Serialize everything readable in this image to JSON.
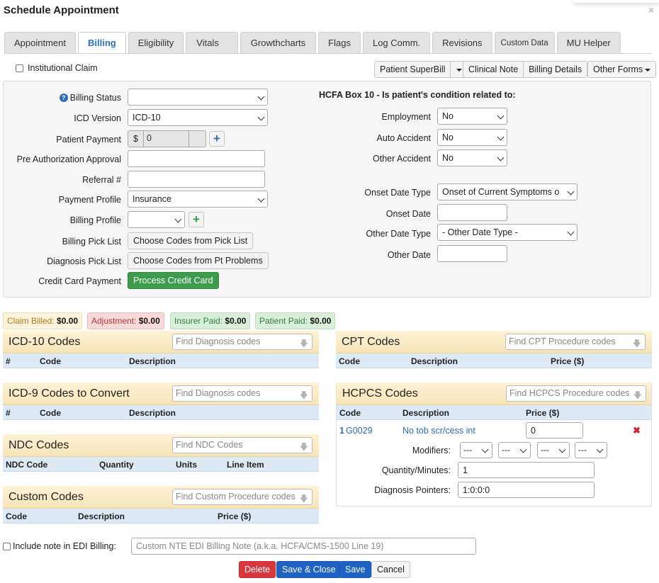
{
  "window": {
    "title": "Schedule Appointment",
    "close_label": "×"
  },
  "tabs": [
    {
      "label": "Appointment"
    },
    {
      "label": "Billing"
    },
    {
      "label": "Eligibility"
    },
    {
      "label": "Vitals"
    },
    {
      "label": "Growthcharts"
    },
    {
      "label": "Flags"
    },
    {
      "label": "Log Comm."
    },
    {
      "label": "Revisions"
    },
    {
      "label": "Custom Data"
    },
    {
      "label": "MU Helper"
    }
  ],
  "institutional_claim": {
    "label": "Institutional Claim",
    "checked": false
  },
  "toolbar": {
    "superbill": "Patient SuperBill",
    "clinical_note": "Clinical Note",
    "billing_details": "Billing Details",
    "other_forms": "Other Forms"
  },
  "billing_form": {
    "billing_status": {
      "label": "Billing Status",
      "value": ""
    },
    "icd_version": {
      "label": "ICD Version",
      "value": "ICD-10"
    },
    "patient_payment": {
      "label": "Patient Payment",
      "currency": "$",
      "value": "0"
    },
    "pre_auth": {
      "label": "Pre Authorization Approval",
      "value": ""
    },
    "referral": {
      "label": "Referral #",
      "value": ""
    },
    "payment_profile": {
      "label": "Payment Profile",
      "value": "Insurance"
    },
    "billing_profile": {
      "label": "Billing Profile",
      "value": ""
    },
    "billing_pick_list": {
      "label": "Billing Pick List",
      "button": "Choose Codes from Pick List"
    },
    "diagnosis_pick_list": {
      "label": "Diagnosis Pick List",
      "button": "Choose Codes from Pt Problems"
    },
    "credit_card": {
      "label": "Credit Card Payment",
      "button": "Process Credit Card"
    }
  },
  "hcfa": {
    "heading": "HCFA Box 10 - Is patient's condition related to:",
    "employment": {
      "label": "Employment",
      "value": "No"
    },
    "auto_accident": {
      "label": "Auto Accident",
      "value": "No"
    },
    "other_accident": {
      "label": "Other Accident",
      "value": "No"
    },
    "onset_date_type": {
      "label": "Onset Date Type",
      "value": "Onset of Current Symptoms o"
    },
    "onset_date": {
      "label": "Onset Date",
      "value": ""
    },
    "other_date_type": {
      "label": "Other Date Type",
      "value": "- Other Date Type -"
    },
    "other_date": {
      "label": "Other Date",
      "value": ""
    }
  },
  "badges": {
    "claim_billed": {
      "label": "Claim Billed:",
      "value": "$0.00",
      "color": "#fdf3dc"
    },
    "adjustment": {
      "label": "Adjustment:",
      "value": "$0.00",
      "color": "#f8d9d9"
    },
    "insurer_paid": {
      "label": "Insurer Paid:",
      "value": "$0.00",
      "color": "#d9efd9"
    },
    "patient_paid": {
      "label": "Patient Paid:",
      "value": "$0.00",
      "color": "#d9efd9"
    }
  },
  "icd10": {
    "title": "ICD-10 Codes",
    "search_placeholder": "Find Diagnosis codes",
    "columns": [
      "#",
      "Code",
      "Description"
    ]
  },
  "icd9": {
    "title": "ICD-9 Codes to Convert",
    "search_placeholder": "Find Diagnosis codes",
    "columns": [
      "#",
      "Code",
      "Description"
    ]
  },
  "ndc": {
    "title": "NDC Codes",
    "search_placeholder": "Find NDC Codes",
    "columns": [
      "NDC Code",
      "Quantity",
      "Units",
      "Line Item"
    ]
  },
  "custom": {
    "title": "Custom Codes",
    "search_placeholder": "Find Custom Procedure codes",
    "columns": [
      "Code",
      "Description",
      "Price ($)"
    ]
  },
  "cpt": {
    "title": "CPT Codes",
    "search_placeholder": "Find CPT Procedure codes",
    "columns": [
      "Code",
      "Description",
      "Price ($)"
    ]
  },
  "hcpcs": {
    "title": "HCPCS Codes",
    "search_placeholder": "Find HCPCS Procedure codes",
    "columns": [
      "Code",
      "Description",
      "Price ($)"
    ],
    "rows": [
      {
        "num": "1",
        "code": "G0029",
        "description": "No tob scr/cess int",
        "price": "0",
        "modifiers_label": "Modifiers:",
        "modifiers": [
          "---",
          "---",
          "---",
          "---"
        ],
        "quantity_label": "Quantity/Minutes:",
        "quantity": "1",
        "pointers_label": "Diagnosis Pointers:",
        "pointers": "1:0:0:0"
      }
    ]
  },
  "edi_note": {
    "label": "Include note in EDI Billing:",
    "checked": false,
    "placeholder": "Custom NTE EDI Billing Note (a.k.a. HCFA/CMS-1500 Line 19)"
  },
  "footer": {
    "delete": "Delete",
    "save_close": "Save & Close",
    "save": "Save",
    "cancel": "Cancel"
  },
  "colors": {
    "accent": "#2a6ebb",
    "danger": "#d9222a",
    "success": "#3d9c4c",
    "section_header": "#f6e4b8",
    "table_header": "#dde9f5"
  }
}
